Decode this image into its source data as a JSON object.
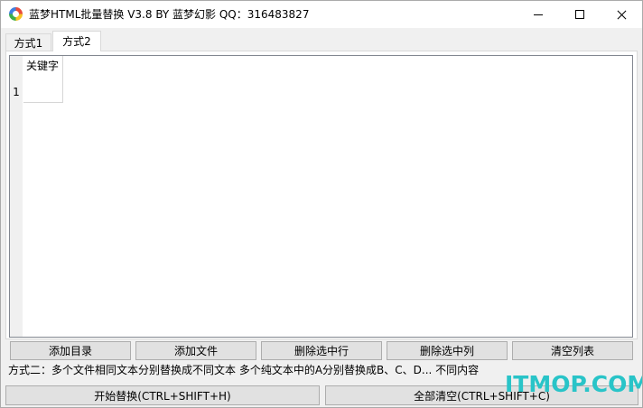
{
  "window": {
    "title": "蓝梦HTML批量替换 V3.8 BY 蓝梦幻影 QQ：316483827"
  },
  "tabs": [
    {
      "label": "方式1",
      "selected": false
    },
    {
      "label": "方式2",
      "selected": true
    }
  ],
  "grid": {
    "columns": [
      "关键字"
    ],
    "rows": [
      "1"
    ]
  },
  "actions": {
    "add_dir": "添加目录",
    "add_file": "添加文件",
    "delete_row": "删除选中行",
    "delete_col": "删除选中列",
    "clear_list": "清空列表"
  },
  "description": "方式二：多个文件相同文本分别替换成不同文本  多个纯文本中的A分别替换成B、C、D... 不同内容",
  "footer": {
    "start": "开始替换(CTRL+SHIFT+H)",
    "clear_all": "全部清空(CTRL+SHIFT+C)"
  },
  "watermark": "ITMOP.COM",
  "colors": {
    "watermark": "#29c4c8",
    "background": "#f0f0f0"
  }
}
